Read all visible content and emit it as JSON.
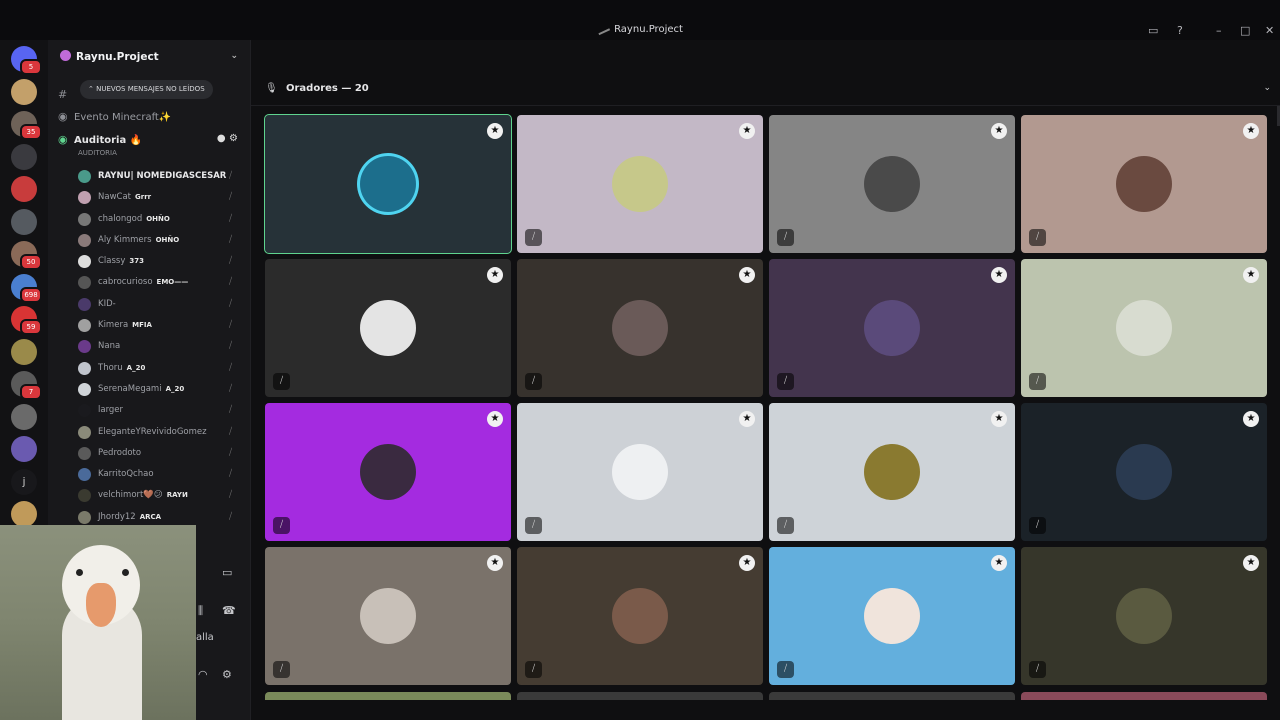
{
  "window": {
    "title": "Raynu.Project"
  },
  "servers": [
    {
      "name": "discord-home",
      "color": "#5865f2",
      "badge": "5"
    },
    {
      "name": "server-2",
      "color": "#c3a06a",
      "badge": ""
    },
    {
      "name": "server-3",
      "color": "#6e6258",
      "badge": "35"
    },
    {
      "name": "server-4",
      "color": "#3a3a3f",
      "badge": ""
    },
    {
      "name": "server-5",
      "color": "#c83c3c",
      "badge": ""
    },
    {
      "name": "server-6",
      "color": "#555a60",
      "badge": ""
    },
    {
      "name": "server-7",
      "color": "#8a6a58",
      "badge": "50"
    },
    {
      "name": "server-8",
      "color": "#4a7fd0",
      "badge": "698"
    },
    {
      "name": "server-9",
      "color": "#d83434",
      "badge": "59"
    },
    {
      "name": "server-10",
      "color": "#9a8a4a",
      "badge": ""
    },
    {
      "name": "server-11",
      "color": "#5a5a5a",
      "badge": "7"
    },
    {
      "name": "server-12",
      "color": "#6a6a6a",
      "badge": ""
    },
    {
      "name": "server-13",
      "color": "#6a5ab0",
      "badge": ""
    },
    {
      "name": "server-14",
      "color": "#18181b",
      "badge": "",
      "letter": "j"
    },
    {
      "name": "server-15",
      "color": "#c09a5a",
      "badge": ""
    }
  ],
  "sidebar": {
    "server_name": "Raynu.Project",
    "unread_pill": "NUEVOS MENSAJES NO LEÍDOS",
    "event_channel": "Evento Minecraft✨",
    "stage_channel": "Auditoria 🔥",
    "stage_subtitle": "AUDITORIA",
    "users": [
      {
        "name": "RAYNU| NOMEDIGASCESAR",
        "tag": "",
        "color": "#4a9a8a",
        "bright": true
      },
      {
        "name": "NawCat",
        "tag": "Grrr",
        "color": "#c0a0b0"
      },
      {
        "name": "chalongod",
        "tag": "OHÑO",
        "color": "#777"
      },
      {
        "name": "Aly Kimmers",
        "tag": "OHÑO",
        "color": "#8a7a7a"
      },
      {
        "name": "Classy",
        "tag": "373",
        "color": "#ddd"
      },
      {
        "name": "cabrocurioso",
        "tag": "EMO——",
        "color": "#555"
      },
      {
        "name": "KID-",
        "tag": "",
        "color": "#4a3a6a"
      },
      {
        "name": "Kimera",
        "tag": "MFIA",
        "color": "#a0a0a0"
      },
      {
        "name": "Nana",
        "tag": "",
        "color": "#6a3a8a"
      },
      {
        "name": "Thoru",
        "tag": "A_20",
        "color": "#c0c4cc"
      },
      {
        "name": "SerenaMegami",
        "tag": "A_20",
        "color": "#d0d4d8"
      },
      {
        "name": "larger",
        "tag": "",
        "color": "#1a1a1e"
      },
      {
        "name": "EleganteYRevividoGomez",
        "tag": "",
        "color": "#8a8a7a"
      },
      {
        "name": "Pedrodoto",
        "tag": "",
        "color": "#5a5a5a"
      },
      {
        "name": "KarritoQchao",
        "tag": "",
        "color": "#4a6a9a"
      },
      {
        "name": "velchimort🤎😕",
        "tag": "RAYИ",
        "color": "#3a3a30"
      },
      {
        "name": "Jhordy12",
        "tag": "ARCA",
        "color": "#7a7a6a"
      }
    ]
  },
  "controls": {
    "screen_share_label": "alla"
  },
  "stage": {
    "speakers_label": "Oradores — 20",
    "tiles": [
      {
        "bg": "#263238",
        "avatar": "#1c6e8c",
        "active": true
      },
      {
        "bg": "#c3b8c6",
        "avatar": "#c6c88a"
      },
      {
        "bg": "#858585",
        "avatar": "#4a4a4a"
      },
      {
        "bg": "#b29990",
        "avatar": "#6a4a40"
      },
      {
        "bg": "#2b2b2b",
        "avatar": "#e4e4e4"
      },
      {
        "bg": "#37322d",
        "avatar": "#6a5a58"
      },
      {
        "bg": "#43344d",
        "avatar": "#5a4a7a"
      },
      {
        "bg": "#bcc4ae",
        "avatar": "#d8dcd0"
      },
      {
        "bg": "#a42be0",
        "avatar": "#3a2a40"
      },
      {
        "bg": "#cdd1d6",
        "avatar": "#eef0f2"
      },
      {
        "bg": "#ced3d8",
        "avatar": "#8a7a30"
      },
      {
        "bg": "#1b2228",
        "avatar": "#2a3a50"
      },
      {
        "bg": "#7a726a",
        "avatar": "#c8c0b8"
      },
      {
        "bg": "#453c32",
        "avatar": "#7a5a4a"
      },
      {
        "bg": "#63afdd",
        "avatar": "#f0e4dc"
      },
      {
        "bg": "#36362a",
        "avatar": "#5a5a40"
      }
    ],
    "peek_colors": [
      "#7a8a5a",
      "#3a3a3a",
      "#3a3a3a",
      "#8a4a5a"
    ]
  }
}
